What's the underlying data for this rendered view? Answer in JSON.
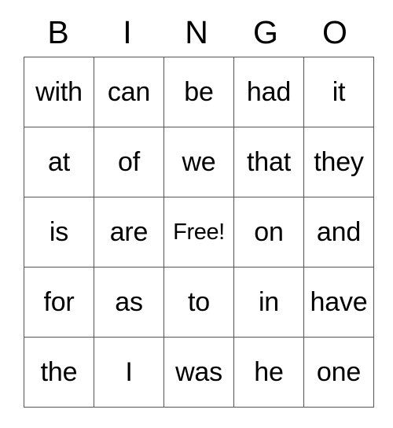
{
  "card": {
    "header": {
      "letters": [
        "B",
        "I",
        "N",
        "G",
        "O"
      ]
    },
    "grid": {
      "columns": 5,
      "rows": 5,
      "free_space": {
        "row": 2,
        "col": 2,
        "label": "Free!"
      },
      "cells": [
        [
          "with",
          "can",
          "be",
          "had",
          "it"
        ],
        [
          "at",
          "of",
          "we",
          "that",
          "they"
        ],
        [
          "is",
          "are",
          "Free!",
          "on",
          "and"
        ],
        [
          "for",
          "as",
          "to",
          "in",
          "have"
        ],
        [
          "the",
          "I",
          "was",
          "he",
          "one"
        ]
      ]
    },
    "colors": {
      "background": "#ffffff",
      "text": "#000000",
      "grid_line": "#555555",
      "grid_outer_border": "#3a3a3a"
    }
  }
}
